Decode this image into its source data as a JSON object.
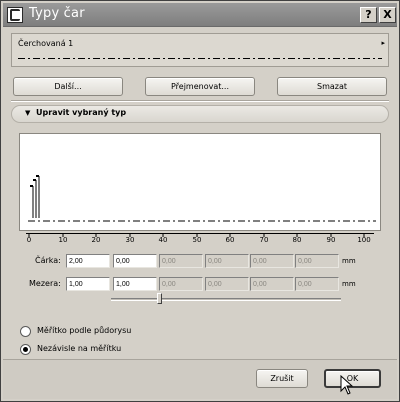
{
  "window": {
    "title": "Typy čar"
  },
  "titlebar": {
    "help_label": "?",
    "close_label": "X"
  },
  "line_type": {
    "selected": "Čerchovaná 1",
    "arrow": "▸"
  },
  "buttons": {
    "next": "Další...",
    "rename": "Přejmenovat...",
    "delete": "Smazat"
  },
  "edit_section": {
    "arrow": "▼",
    "label": "Upravit vybraný typ"
  },
  "ruler": {
    "labels": [
      "0",
      "10",
      "20",
      "30",
      "40",
      "50",
      "60",
      "70",
      "80",
      "90",
      "100"
    ]
  },
  "dash_row": {
    "label": "Čárka:",
    "values": [
      "2,00",
      "0,00",
      "0,00",
      "0,00",
      "0,00",
      "0,00"
    ],
    "unit": "mm"
  },
  "gap_row": {
    "label": "Mezera:",
    "values": [
      "1,00",
      "1,00",
      "0,00",
      "0,00",
      "0,00",
      "0,00"
    ],
    "unit": "mm"
  },
  "scale_options": {
    "option1": "Měřítko podle půdorysu",
    "option2": "Nezávisle na měřítku",
    "selected": "Nezávisle na měřítku"
  },
  "footer": {
    "cancel": "Zrušit",
    "ok": "OK"
  },
  "colors": {
    "titlebar": "#8a8a8a",
    "dialog": "#d4d0c8",
    "preview_bg": "#ffffff"
  }
}
